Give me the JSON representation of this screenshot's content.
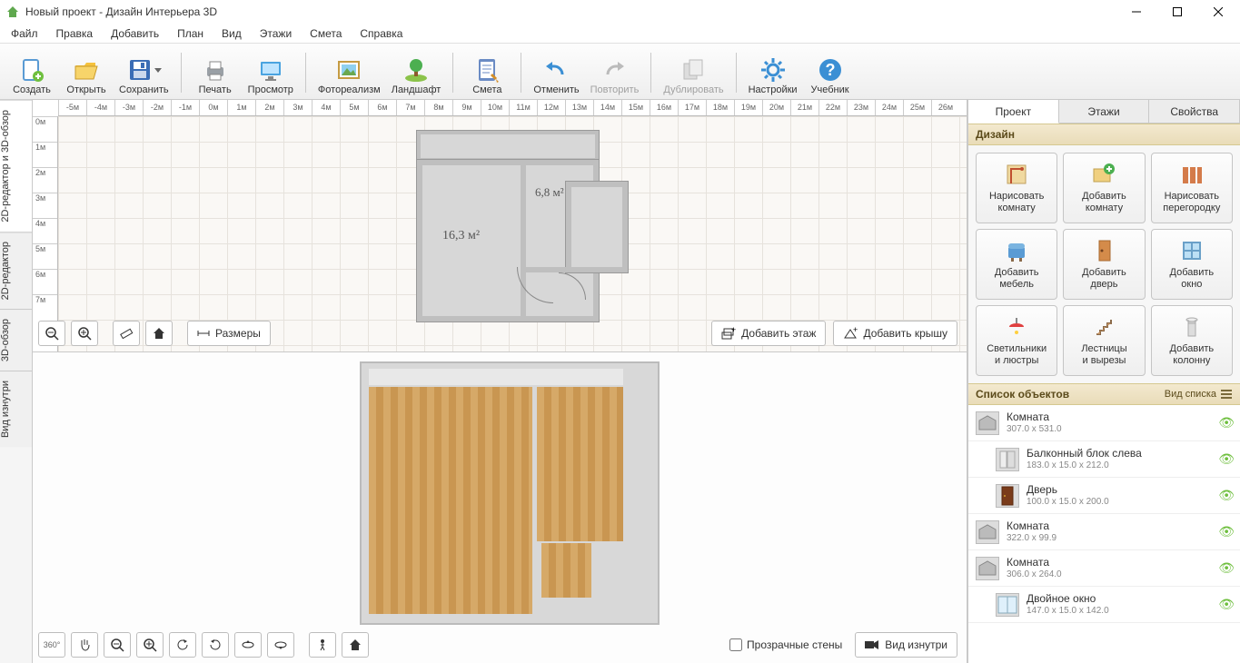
{
  "title": "Новый проект - Дизайн Интерьера 3D",
  "menu": [
    "Файл",
    "Правка",
    "Добавить",
    "План",
    "Вид",
    "Этажи",
    "Смета",
    "Справка"
  ],
  "toolbar": [
    {
      "id": "create",
      "label": "Создать"
    },
    {
      "id": "open",
      "label": "Открыть"
    },
    {
      "id": "save",
      "label": "Сохранить",
      "dropdown": true
    },
    {
      "sep": true
    },
    {
      "id": "print",
      "label": "Печать"
    },
    {
      "id": "preview",
      "label": "Просмотр"
    },
    {
      "sep": true
    },
    {
      "id": "photoreal",
      "label": "Фотореализм"
    },
    {
      "id": "landscape",
      "label": "Ландшафт"
    },
    {
      "sep": true
    },
    {
      "id": "estimate",
      "label": "Смета"
    },
    {
      "sep": true
    },
    {
      "id": "undo",
      "label": "Отменить"
    },
    {
      "id": "redo",
      "label": "Повторить",
      "disabled": true
    },
    {
      "sep": true
    },
    {
      "id": "duplicate",
      "label": "Дублировать",
      "disabled": true
    },
    {
      "sep": true
    },
    {
      "id": "settings",
      "label": "Настройки"
    },
    {
      "id": "tutorial",
      "label": "Учебник"
    }
  ],
  "vtabs": [
    "2D-редактор и 3D-обзор",
    "2D-редактор",
    "3D-обзор",
    "Вид изнутри"
  ],
  "ruler_h": [
    "-5м",
    "-4м",
    "-3м",
    "-2м",
    "-1м",
    "0м",
    "1м",
    "2м",
    "3м",
    "4м",
    "5м",
    "6м",
    "7м",
    "8м",
    "9м",
    "10м",
    "11м",
    "12м",
    "13м",
    "14м",
    "15м",
    "16м",
    "17м",
    "18м",
    "19м",
    "20м",
    "21м",
    "22м",
    "23м",
    "24м",
    "25м",
    "26м"
  ],
  "ruler_v": [
    "0м",
    "1м",
    "2м",
    "3м",
    "4м",
    "5м",
    "6м",
    "7м"
  ],
  "plan_labels": {
    "big": "16,3 м²",
    "small": "6,8 м²"
  },
  "plan_tools": {
    "sizes": "Размеры",
    "add_floor": "Добавить этаж",
    "add_roof": "Добавить крышу"
  },
  "view3d": {
    "transparent_walls": "Прозрачные стены",
    "inside_view": "Вид изнутри"
  },
  "right": {
    "tabs": [
      "Проект",
      "Этажи",
      "Свойства"
    ],
    "design_header": "Дизайн",
    "cards": [
      {
        "t1": "Нарисовать",
        "t2": "комнату"
      },
      {
        "t1": "Добавить",
        "t2": "комнату"
      },
      {
        "t1": "Нарисовать",
        "t2": "перегородку"
      },
      {
        "t1": "Добавить",
        "t2": "мебель"
      },
      {
        "t1": "Добавить",
        "t2": "дверь"
      },
      {
        "t1": "Добавить",
        "t2": "окно"
      },
      {
        "t1": "Светильники",
        "t2": "и люстры"
      },
      {
        "t1": "Лестницы",
        "t2": "и вырезы"
      },
      {
        "t1": "Добавить",
        "t2": "колонну"
      }
    ],
    "objects_header": "Список объектов",
    "view_mode": "Вид списка",
    "objects": [
      {
        "name": "Комната",
        "dims": "307.0 x 531.0",
        "indent": 0
      },
      {
        "name": "Балконный блок слева",
        "dims": "183.0 x 15.0 x 212.0",
        "indent": 1
      },
      {
        "name": "Дверь",
        "dims": "100.0 x 15.0 x 200.0",
        "indent": 1
      },
      {
        "name": "Комната",
        "dims": "322.0 x 99.9",
        "indent": 0
      },
      {
        "name": "Комната",
        "dims": "306.0 x 264.0",
        "indent": 0
      },
      {
        "name": "Двойное окно",
        "dims": "147.0 x 15.0 x 142.0",
        "indent": 1
      }
    ]
  }
}
